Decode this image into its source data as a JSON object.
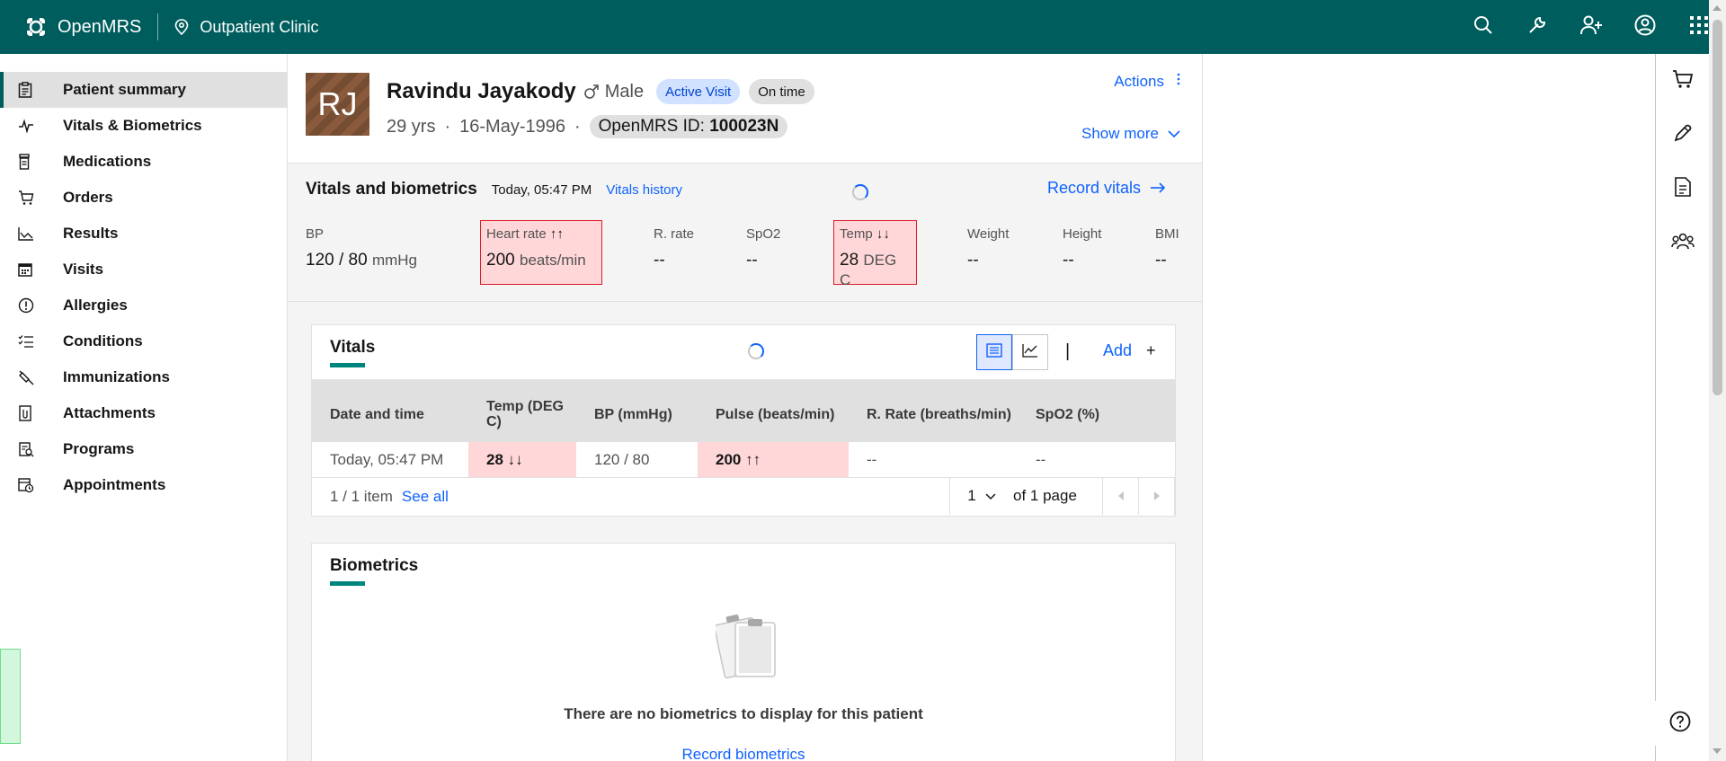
{
  "header": {
    "brand": "OpenMRS",
    "location": "Outpatient Clinic",
    "actions": [
      "search-icon",
      "tools-icon",
      "add-user-icon",
      "user-icon",
      "app-switcher-icon"
    ]
  },
  "nav": {
    "items": [
      {
        "label": "Patient summary",
        "icon": "clipboard-icon",
        "active": true
      },
      {
        "label": "Vitals & Biometrics",
        "icon": "activity-icon"
      },
      {
        "label": "Medications",
        "icon": "medication-icon"
      },
      {
        "label": "Orders",
        "icon": "cart-icon"
      },
      {
        "label": "Results",
        "icon": "chart-icon"
      },
      {
        "label": "Visits",
        "icon": "calendar-icon"
      },
      {
        "label": "Allergies",
        "icon": "warning-icon"
      },
      {
        "label": "Conditions",
        "icon": "checklist-icon"
      },
      {
        "label": "Immunizations",
        "icon": "syringe-icon"
      },
      {
        "label": "Attachments",
        "icon": "attachment-icon"
      },
      {
        "label": "Programs",
        "icon": "program-icon"
      },
      {
        "label": "Appointments",
        "icon": "appointment-icon"
      }
    ]
  },
  "patient": {
    "initials": "RJ",
    "name": "Ravindu Jayakody",
    "gender": "Male",
    "visit_tag": "Active Visit",
    "time_tag": "On time",
    "age": "29 yrs",
    "dob": "16-May-1996",
    "id_label": "OpenMRS ID:",
    "id_value": "100023N",
    "actions_label": "Actions",
    "show_more_label": "Show more"
  },
  "vitals_header": {
    "title": "Vitals and biometrics",
    "time": "Today, 05:47 PM",
    "history_link": "Vitals history",
    "record_link": "Record vitals",
    "bp": {
      "label": "BP",
      "value": "120 / 80",
      "unit": "mmHg"
    },
    "heart_rate": {
      "label": "Heart rate",
      "arrows": "↑↑",
      "value": "200",
      "unit": "beats/min"
    },
    "r_rate": {
      "label": "R. rate",
      "value": "--"
    },
    "spo2": {
      "label": "SpO2",
      "value": "--"
    },
    "temp": {
      "label": "Temp",
      "arrows": "↓↓",
      "value": "28",
      "unit": "DEG C"
    },
    "weight": {
      "label": "Weight",
      "value": "--"
    },
    "height": {
      "label": "Height",
      "value": "--"
    },
    "bmi": {
      "label": "BMI",
      "value": "--"
    }
  },
  "vitals_card": {
    "title": "Vitals",
    "separator": "|",
    "add_label": "Add",
    "add_icon": "+",
    "columns": [
      "Date and time",
      "Temp (DEG C)",
      "BP (mmHg)",
      "Pulse (beats/min)",
      "R. Rate (breaths/min)",
      "SpO2 (%)"
    ],
    "rows": [
      {
        "date": "Today, 05:47 PM",
        "temp": "28 ↓↓",
        "bp": "120 / 80",
        "pulse": "200 ↑↑",
        "rrate": "--",
        "spo2": "--"
      }
    ],
    "pager": {
      "count": "1 / 1 item",
      "see_all": "See all",
      "page": "1",
      "of_pages": "of 1 page"
    }
  },
  "biometrics_card": {
    "title": "Biometrics",
    "empty_text": "There are no biometrics to display for this patient",
    "record_link": "Record biometrics"
  },
  "colors": {
    "brand": "#005d5d",
    "link": "#0f62fe",
    "alert_bg": "#ffd7d9",
    "alert_border": "#da1e28",
    "accent": "#00857d"
  }
}
